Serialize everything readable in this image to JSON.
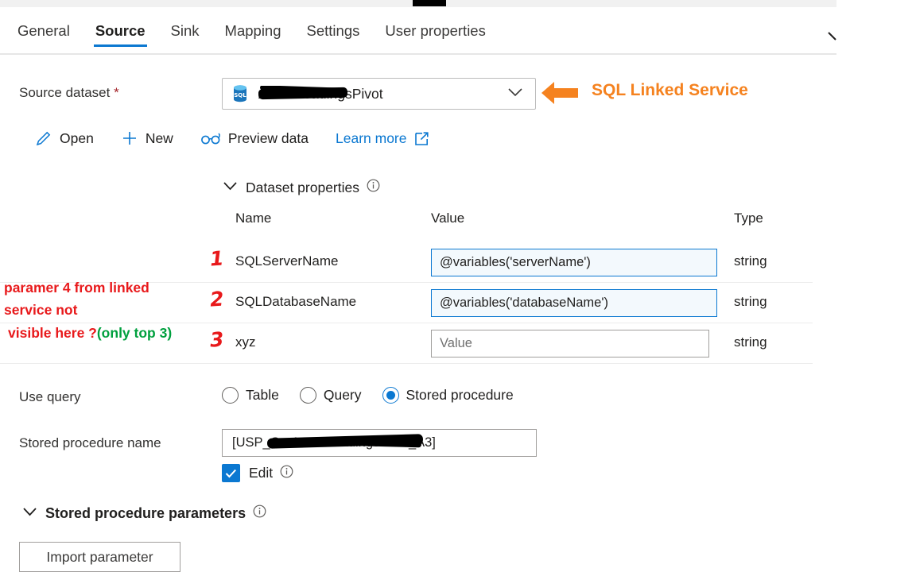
{
  "tabs": [
    {
      "label": "General",
      "active": false
    },
    {
      "label": "Source",
      "active": true
    },
    {
      "label": "Sink",
      "active": false
    },
    {
      "label": "Mapping",
      "active": false
    },
    {
      "label": "Settings",
      "active": false
    },
    {
      "label": "User properties",
      "active": false
    }
  ],
  "source": {
    "dataset_label": "Source dataset",
    "required_mark": "*",
    "dataset_value": "AssetReadingsPivot",
    "dataset_icon": "sql-database-icon",
    "chevron_icon": "chevron-down-icon"
  },
  "annotations": {
    "orange_arrow": "arrow-left-icon",
    "orange_text": "SQL Linked Service",
    "orange_color": "#f5821f",
    "red_color": "#e8191b",
    "green_color": "#00a03e",
    "note_line1": "paramer 4 from linked",
    "note_line2": "service not",
    "note_line3_red": "visible here ?",
    "note_line3_green": "(only top 3)",
    "row_numbers": [
      "1",
      "2",
      "3"
    ]
  },
  "actions": [
    {
      "label": "Open",
      "icon": "pencil-icon"
    },
    {
      "label": "New",
      "icon": "plus-icon"
    },
    {
      "label": "Preview data",
      "icon": "glasses-icon"
    },
    {
      "label": "Learn more",
      "icon": "external-link-icon"
    }
  ],
  "dataset_properties": {
    "section_title": "Dataset properties",
    "collapse_icon": "chevron-down-icon",
    "info_icon": "info-icon",
    "headers": {
      "name": "Name",
      "value": "Value",
      "type": "Type"
    },
    "rows": [
      {
        "name": "SQLServerName",
        "value": "@variables('serverName')",
        "placeholder": "",
        "type": "string",
        "filled": true
      },
      {
        "name": "SQLDatabaseName",
        "value": "@variables('databaseName')",
        "placeholder": "",
        "type": "string",
        "filled": true
      },
      {
        "name": "xyz",
        "value": "",
        "placeholder": "Value",
        "type": "string",
        "filled": false
      }
    ]
  },
  "use_query": {
    "label": "Use query",
    "options": [
      {
        "label": "Table",
        "selected": false
      },
      {
        "label": "Query",
        "selected": false
      },
      {
        "label": "Stored procedure",
        "selected": true
      }
    ]
  },
  "stored_procedure": {
    "name_label": "Stored procedure name",
    "name_prefix": "[USP_",
    "name_suffix": "]",
    "name_value": "[USP_GetAssetReadingsPivot_A3]",
    "edit_label": "Edit",
    "edit_checked": true,
    "edit_info_icon": "info-icon"
  },
  "stored_procedure_parameters": {
    "section_title": "Stored procedure parameters",
    "collapse_icon": "chevron-down-icon",
    "info_icon": "info-icon",
    "import_button": "Import parameter"
  }
}
